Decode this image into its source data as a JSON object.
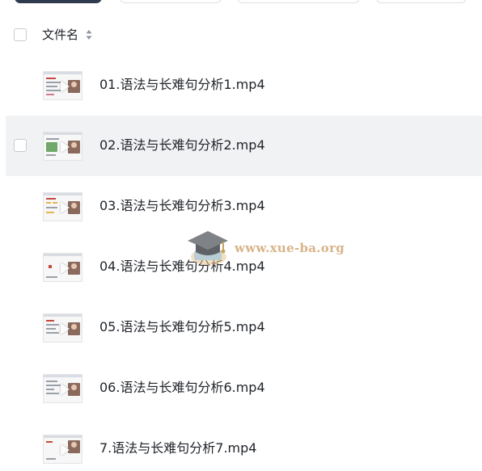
{
  "header": {
    "column_label": "文件名"
  },
  "files": [
    {
      "name": "01.语法与长难句分析1.mp4"
    },
    {
      "name": "02.语法与长难句分析2.mp4"
    },
    {
      "name": "03.语法与长难句分析3.mp4"
    },
    {
      "name": "04.语法与长难句分析4.mp4"
    },
    {
      "name": "05.语法与长难句分析5.mp4"
    },
    {
      "name": "06.语法与长难句分析6.mp4"
    },
    {
      "name": "7.语法与长难句分析7.mp4"
    }
  ],
  "watermark": {
    "text": "www.xue-ba.org"
  },
  "colors": {
    "hover_row": "#f1f2f4",
    "watermark": "#d8b489",
    "primary_button": "#2f3a4f"
  },
  "icons": {
    "sort": "sort-icon",
    "play": "play-icon",
    "watermark_logo": "graduation-cap-icon"
  }
}
